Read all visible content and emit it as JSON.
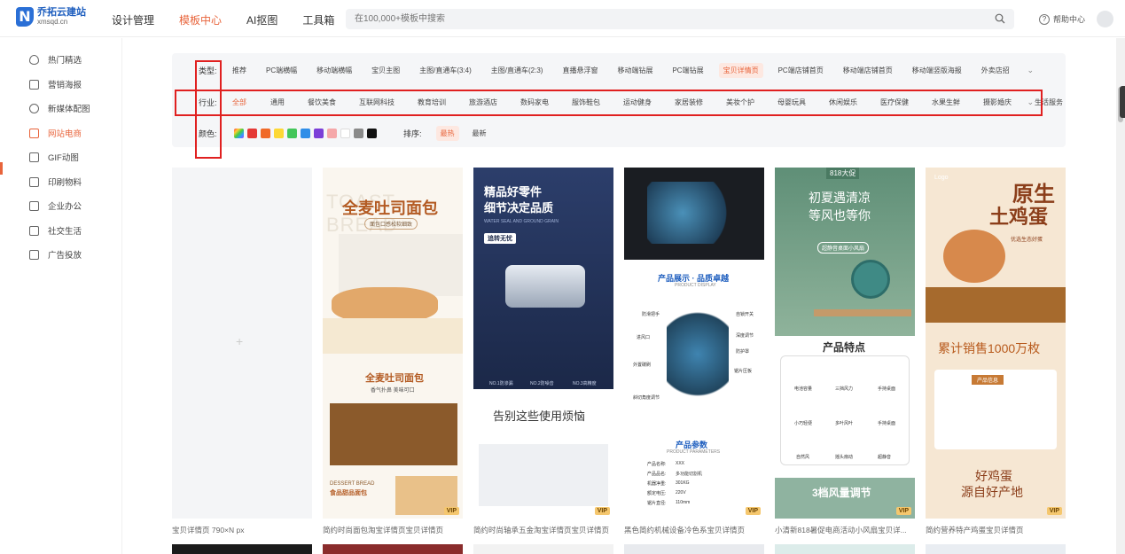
{
  "logo": {
    "mark": "N",
    "name": "乔拓云建站",
    "sub": "xmsqd.cn"
  },
  "topnav": [
    {
      "label": "设计管理",
      "active": false
    },
    {
      "label": "模板中心",
      "active": true
    },
    {
      "label": "AI抠图",
      "active": false
    },
    {
      "label": "工具箱",
      "active": false
    }
  ],
  "search": {
    "placeholder": "在100,000+模板中搜索"
  },
  "help": {
    "label": "帮助中心"
  },
  "sidebar": [
    {
      "label": "热门精选",
      "icon": "fire-icon"
    },
    {
      "label": "营销海报",
      "icon": "poster-icon"
    },
    {
      "label": "新媒体配图",
      "icon": "chat-icon"
    },
    {
      "label": "网站电商",
      "icon": "shop-icon",
      "active": true
    },
    {
      "label": "GIF动图",
      "icon": "gif-icon"
    },
    {
      "label": "印刷物料",
      "icon": "print-icon"
    },
    {
      "label": "企业办公",
      "icon": "briefcase-icon"
    },
    {
      "label": "社交生活",
      "icon": "cup-icon"
    },
    {
      "label": "广告投放",
      "icon": "ad-icon"
    }
  ],
  "filters": {
    "type": {
      "label": "类型:",
      "items": [
        "推荐",
        "PC端横幅",
        "移动端横幅",
        "宝贝主图",
        "主图/直通车(3:4)",
        "主图/直通车(2:3)",
        "直播悬浮窗",
        "移动端钻展",
        "PC端钻展",
        "宝贝详情页",
        "PC端店铺首页",
        "移动端店铺首页",
        "移动端竖版海报",
        "外卖店招"
      ],
      "active_index": 9
    },
    "industry": {
      "label": "行业:",
      "items": [
        "全部",
        "通用",
        "餐饮美食",
        "互联网科技",
        "教育培训",
        "旅游酒店",
        "数码家电",
        "服饰鞋包",
        "运动健身",
        "家居装修",
        "美妆个护",
        "母婴玩具",
        "休闲娱乐",
        "医疗保健",
        "水果生鲜",
        "摄影婚庆",
        "生活服务"
      ],
      "active_index": 0
    },
    "color": {
      "label": "颜色:",
      "swatches": [
        "#e53935",
        "#f06a28",
        "#fdd835",
        "#43c65a",
        "#2f8ee8",
        "#7b3fd8",
        "#f5a7a9",
        "#ffffff",
        "#8a8a8a",
        "#111111"
      ]
    },
    "sort": {
      "label": "排序:",
      "items": [
        "最热",
        "最新"
      ],
      "active_index": 0
    }
  },
  "cards": [
    {
      "caption": "宝贝详情页 790×N px",
      "placeholder": "+"
    },
    {
      "caption": "简约时尚面包淘宝详情页宝贝详情页",
      "texts": [
        "TOAST BREAD",
        "全麦吐司面包",
        "面包口感松软细致",
        "全麦吐司面包",
        "香气扑鼻 美味可口",
        "DESSERT BREAD",
        "食品甜品面包"
      ],
      "vip": "VIP"
    },
    {
      "caption": "简约时尚轴承五金淘宝详情页宝贝详情页",
      "texts": [
        "精品好零件",
        "细节决定品质",
        "WATER SEAL AND GROUND GRAIN",
        "追转无忧",
        "NO.1防渗漏",
        "NO.2防噪音",
        "NO.3高精度",
        "告别这些使用烦恼"
      ],
      "vip": "VIP"
    },
    {
      "caption": "黑色简约机械设备冷色系宝贝详情页",
      "texts": [
        "产品展示 · 品质卓越",
        "PRODUCT DISPLAY",
        "防滑把手",
        "自锁开关",
        "进风口",
        "深度调节",
        "防护罩",
        "外置碳刷",
        "锯片压板",
        "斜切角度调节",
        "产品参数",
        "PRODUCT PARAMETERS",
        "产品名称:",
        "XXX",
        "产品品名:",
        "多功能切割机",
        "机器净重:",
        "301KG",
        "额定电压:",
        "220V",
        "锯片直径:",
        "110mm"
      ],
      "vip": "VIP"
    },
    {
      "caption": "小清新818暑促电商活动小风扇宝贝详...",
      "texts": [
        "818大促",
        "初夏遇清凉",
        "等风也等你",
        "超静音桌面小风扇",
        "产品特点",
        "电池容量",
        "三挡风力",
        "手持桌面",
        "小巧轻便",
        "多叶风叶",
        "手持桌面",
        "自然风",
        "摇头扇动",
        "超静音",
        "3档风量调节"
      ],
      "vip": "VIP"
    },
    {
      "caption": "简约营养特产鸡蛋宝贝详情页",
      "texts": [
        "Logo",
        "原生",
        "土鸡蛋",
        "优选生态好蛋",
        "累计销售1000万枚",
        "产品信息",
        "好鸡蛋",
        "源自好产地"
      ],
      "vip": "VIP"
    }
  ]
}
